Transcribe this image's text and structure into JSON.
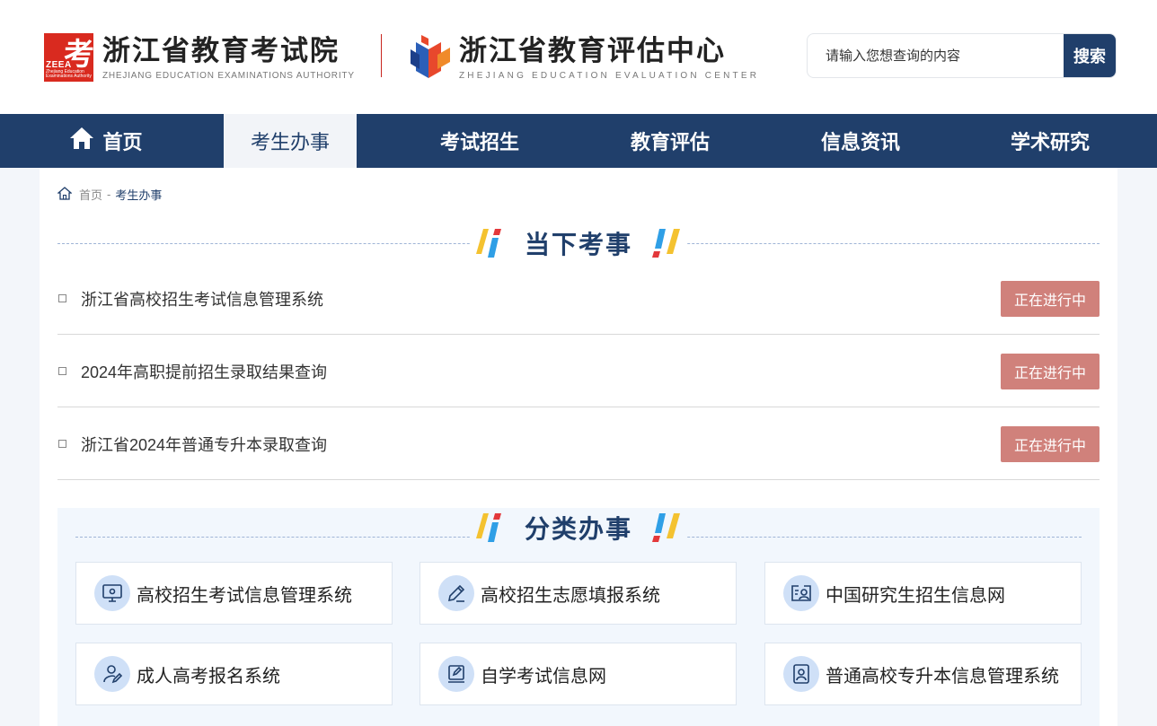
{
  "header": {
    "logo1": {
      "cn": "浙江省教育考试院",
      "en": "ZHEJIANG EDUCATION EXAMINATIONS AUTHORITY",
      "mark_char": "考",
      "mark_abbr": "ZEEA",
      "mark_sub1": "Zhejiang Education",
      "mark_sub2": "Examinations Authority"
    },
    "logo2": {
      "cn": "浙江省教育评估中心",
      "en": "ZHEJIANG EDUCATION EVALUATION CENTER"
    },
    "search": {
      "placeholder": "请输入您想查询的内容",
      "button": "搜索"
    }
  },
  "nav": {
    "items": [
      {
        "label": "首页",
        "icon": "home-icon"
      },
      {
        "label": "考生办事"
      },
      {
        "label": "考试招生"
      },
      {
        "label": "教育评估"
      },
      {
        "label": "信息资讯"
      },
      {
        "label": "学术研究"
      }
    ],
    "active_index": 1
  },
  "breadcrumb": {
    "home": "首页",
    "sep": "-",
    "current": "考生办事"
  },
  "current_affairs": {
    "title": "当下考事",
    "items": [
      {
        "label": "浙江省高校招生考试信息管理系统",
        "status": "正在进行中"
      },
      {
        "label": "2024年高职提前招生录取结果查询",
        "status": "正在进行中"
      },
      {
        "label": "浙江省2024年普通专升本录取查询",
        "status": "正在进行中"
      }
    ]
  },
  "categories": {
    "title": "分类办事",
    "items": [
      {
        "label": "高校招生考试信息管理系统",
        "icon": "monitor-gear-icon"
      },
      {
        "label": "高校招生志愿填报系统",
        "icon": "pencil-icon"
      },
      {
        "label": "中国研究生招生信息网",
        "icon": "id-card-person-icon"
      },
      {
        "label": "成人高考报名系统",
        "icon": "person-edit-icon"
      },
      {
        "label": "自学考试信息网",
        "icon": "book-edit-icon"
      },
      {
        "label": "普通高校专升本信息管理系统",
        "icon": "person-badge-icon"
      }
    ]
  },
  "colors": {
    "primary": "#203f6b",
    "brand_red": "#d92a1f",
    "badge": "#d0817b",
    "slash_yellow": "#f4c230",
    "slash_blue": "#2f9fe6",
    "slash_red": "#e3383b"
  }
}
